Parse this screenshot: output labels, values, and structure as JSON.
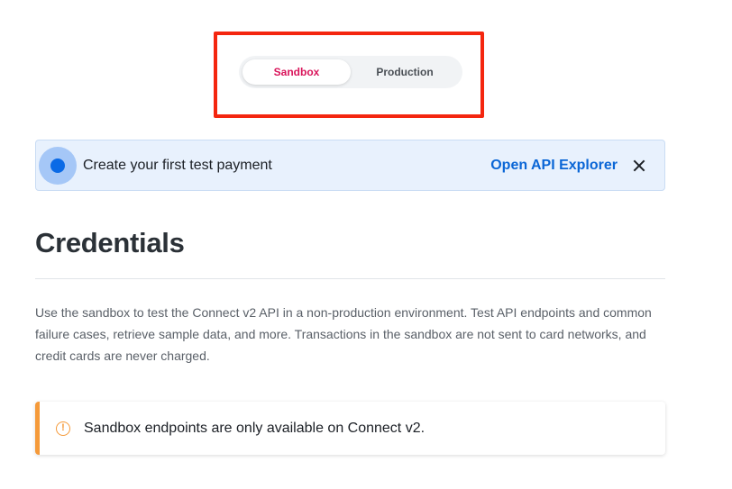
{
  "environment_toggle": {
    "tabs": [
      {
        "label": "Sandbox",
        "active": true
      },
      {
        "label": "Production",
        "active": false
      }
    ]
  },
  "banner": {
    "text": "Create your first test payment",
    "link": "Open API Explorer",
    "close_icon": "close-icon"
  },
  "main": {
    "title": "Credentials",
    "description": "Use the sandbox to test the Connect v2 API in a non-production environment. Test API endpoints and common failure cases, retrieve sample data, and more. Transactions in the sandbox are not sent to card networks, and credit cards are never charged."
  },
  "callout": {
    "icon": "warning-icon",
    "text": "Sandbox endpoints are only available on Connect v2."
  },
  "colors": {
    "highlight": "#f4260f",
    "sandbox_active": "#d9145a",
    "link": "#0a66d6",
    "banner_bg": "#e8f1fd",
    "warning": "#f59a3a"
  }
}
